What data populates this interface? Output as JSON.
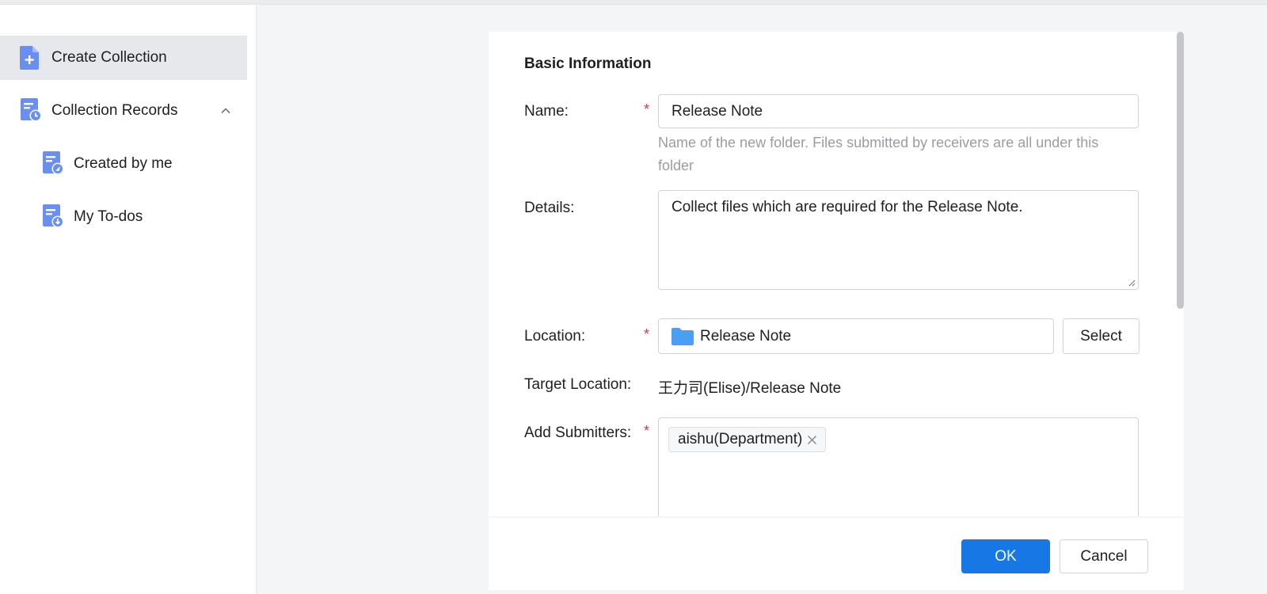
{
  "sidebar": {
    "items": [
      {
        "label": "Create Collection",
        "icon": "doc-plus-icon"
      },
      {
        "label": "Collection Records",
        "icon": "doc-clock-icon"
      },
      {
        "label": "Created by me",
        "icon": "doc-send-icon"
      },
      {
        "label": "My To-dos",
        "icon": "doc-download-icon"
      }
    ]
  },
  "form": {
    "section_title": "Basic Information",
    "name": {
      "label": "Name:",
      "required_mark": "*",
      "value": "Release Note",
      "hint": "Name of the new folder. Files submitted by receivers are all under this folder"
    },
    "details": {
      "label": "Details:",
      "value": "Collect files which are required for the Release Note."
    },
    "location": {
      "label": "Location:",
      "required_mark": "*",
      "value": "Release Note",
      "select_label": "Select"
    },
    "target_location": {
      "label": "Target Location:",
      "value": "王力司(Elise)/Release Note"
    },
    "submitters": {
      "label": "Add Submitters:",
      "required_mark": "*",
      "tags": [
        "aishu(Department)"
      ]
    }
  },
  "footer": {
    "ok_label": "OK",
    "cancel_label": "Cancel"
  },
  "colors": {
    "accent": "#1677e5",
    "icon": "#6b8ff0",
    "required": "#e5323b",
    "folder": "#4a9ff5"
  }
}
